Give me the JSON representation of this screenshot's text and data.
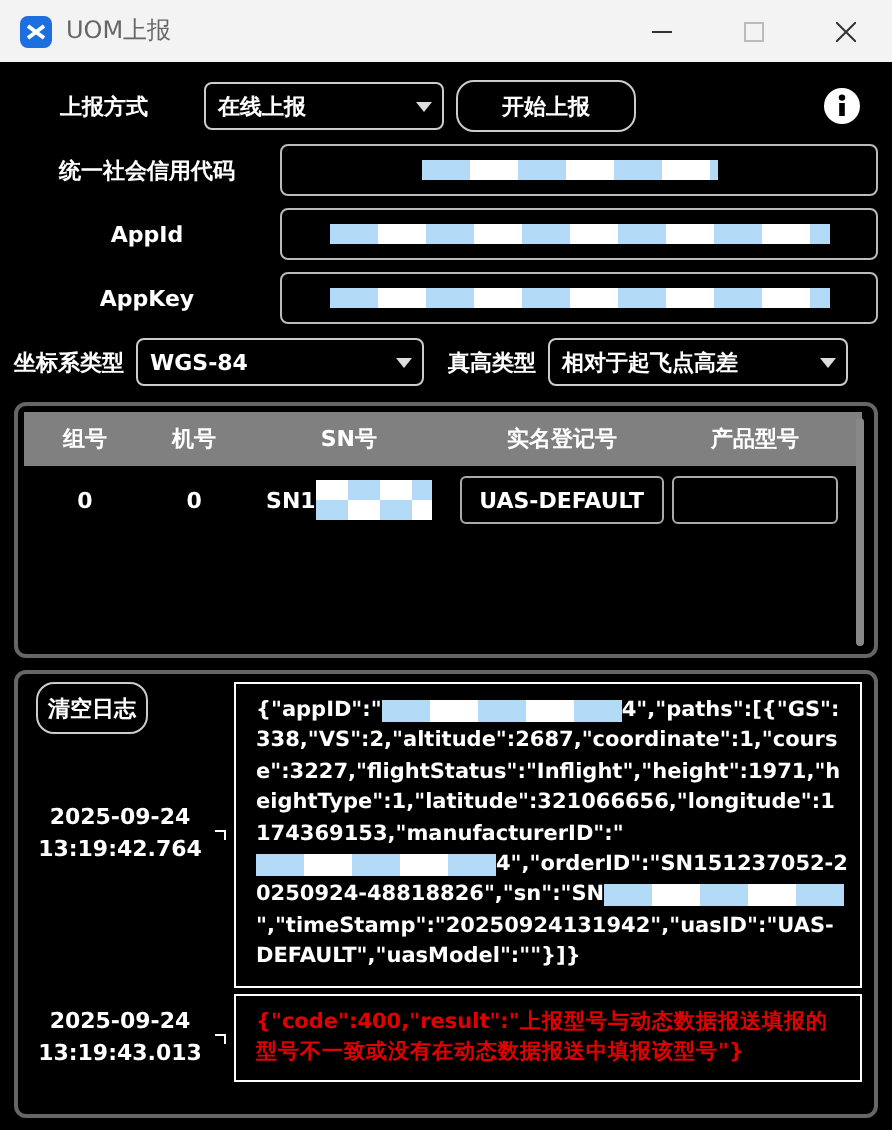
{
  "window": {
    "title": "UOM上报",
    "maximize_disabled": true
  },
  "report_mode": {
    "label": "上报方式",
    "value": "在线上报"
  },
  "start_button": "开始上报",
  "credentials": [
    {
      "label": "统一社会信用代码",
      "redacted": true
    },
    {
      "label": "AppId",
      "redacted": true
    },
    {
      "label": "AppKey",
      "redacted": true
    }
  ],
  "coordinate": {
    "label": "坐标系类型",
    "value": "WGS-84"
  },
  "height_type": {
    "label": "真高类型",
    "value": "相对于起飞点高差"
  },
  "table": {
    "columns": [
      "组号",
      "机号",
      "SN号",
      "实名登记号",
      "产品型号"
    ],
    "rows": [
      {
        "group": "0",
        "number": "0",
        "sn": "SN1",
        "sn_redacted": true,
        "registration": "UAS-DEFAULT",
        "model": ""
      }
    ]
  },
  "clear_log_button": "清空日志",
  "log": [
    {
      "date": "2025-09-24",
      "time": "13:19:42.764",
      "kind": "request",
      "segments": [
        {
          "kind": "text",
          "text": "{\"appID\":\""
        },
        {
          "kind": "redacted"
        },
        {
          "kind": "text",
          "text": "4\",\"paths\":[{\"GS\":338,\"VS\":2,\"altitude\":2687,\"coordinate\":1,\"course\":3227,\"flightStatus\":\"Inflight\",\"height\":1971,\"heightType\":1,\"latitude\":321066656,\"longitude\":1174369153,\"manufacturerID\":\""
        },
        {
          "kind": "redacted"
        },
        {
          "kind": "text",
          "text": "4\",\"orderID\":\"SN151237052-20250924-48818826\",\"sn\":\"SN"
        },
        {
          "kind": "redacted"
        },
        {
          "kind": "text",
          "text": "\",\"timeStamp\":\"20250924131942\",\"uasID\":\"UAS-DEFAULT\",\"uasModel\":\"\"}]}"
        }
      ]
    },
    {
      "date": "2025-09-24",
      "time": "13:19:43.013",
      "kind": "error",
      "segments": [
        {
          "kind": "text",
          "text": "{\"code\":400,\"result\":\"上报型号与动态数据报送填报的型号不一致或没有在动态数据报送中填报该型号\"}"
        }
      ]
    }
  ]
}
